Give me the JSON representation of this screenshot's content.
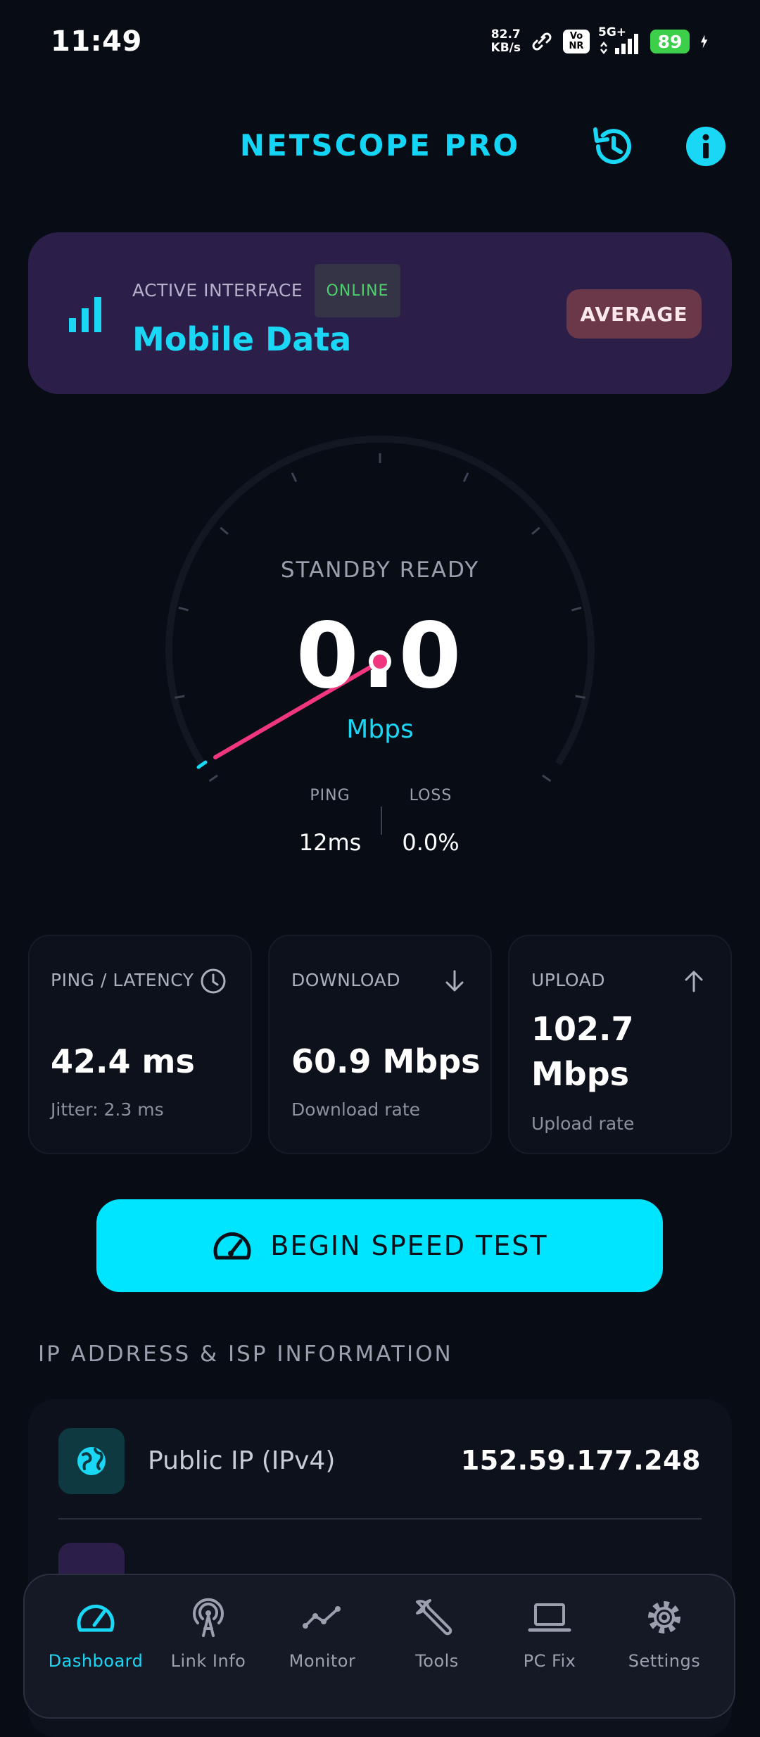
{
  "status_bar": {
    "time": "11:49",
    "net_speed_value": "82.7",
    "net_speed_unit": "KB/s",
    "volte_label_top": "Vo",
    "volte_label_bottom": "NR",
    "network_type": "5G+",
    "battery": "89"
  },
  "header": {
    "title": "NETSCOPE PRO",
    "history_icon": "history-icon",
    "info_icon": "info-icon"
  },
  "interface_card": {
    "label": "ACTIVE INTERFACE",
    "status": "ONLINE",
    "name": "Mobile Data",
    "quality": "AVERAGE",
    "icon": "signal-bars-icon"
  },
  "gauge": {
    "state": "STANDBY READY",
    "value": "0.0",
    "unit": "Mbps",
    "ping_label": "PING",
    "ping_value": "12ms",
    "loss_label": "LOSS",
    "loss_value": "0.0%"
  },
  "stats": [
    {
      "title": "PING / LATENCY",
      "value": "42.4 ms",
      "sub": "Jitter: 2.3 ms",
      "icon": "clock-icon"
    },
    {
      "title": "DOWNLOAD",
      "value": "60.9 Mbps",
      "sub": "Download rate",
      "icon": "arrow-down-icon"
    },
    {
      "title": "UPLOAD",
      "value": "102.7 Mbps",
      "sub": "Upload rate",
      "icon": "arrow-up-icon"
    }
  ],
  "begin_button": {
    "label": "BEGIN SPEED TEST",
    "icon": "speedometer-icon"
  },
  "ip_section": {
    "title": "IP ADDRESS & ISP INFORMATION",
    "rows": [
      {
        "label": "Public IP (IPv4)",
        "value": "152.59.177.248",
        "icon": "globe-icon"
      }
    ]
  },
  "nav": {
    "items": [
      {
        "label": "Dashboard",
        "icon": "dashboard-icon",
        "active": true
      },
      {
        "label": "Link Info",
        "icon": "antenna-icon",
        "active": false
      },
      {
        "label": "Monitor",
        "icon": "monitor-graph-icon",
        "active": false
      },
      {
        "label": "Tools",
        "icon": "wrench-icon",
        "active": false
      },
      {
        "label": "PC Fix",
        "icon": "laptop-icon",
        "active": false
      },
      {
        "label": "Settings",
        "icon": "gear-icon",
        "active": false
      }
    ]
  },
  "colors": {
    "accent": "#19d7f5",
    "background": "#080c15",
    "card": "#2b1f4a",
    "needle": "#f0367e",
    "online": "#4cd06a"
  }
}
